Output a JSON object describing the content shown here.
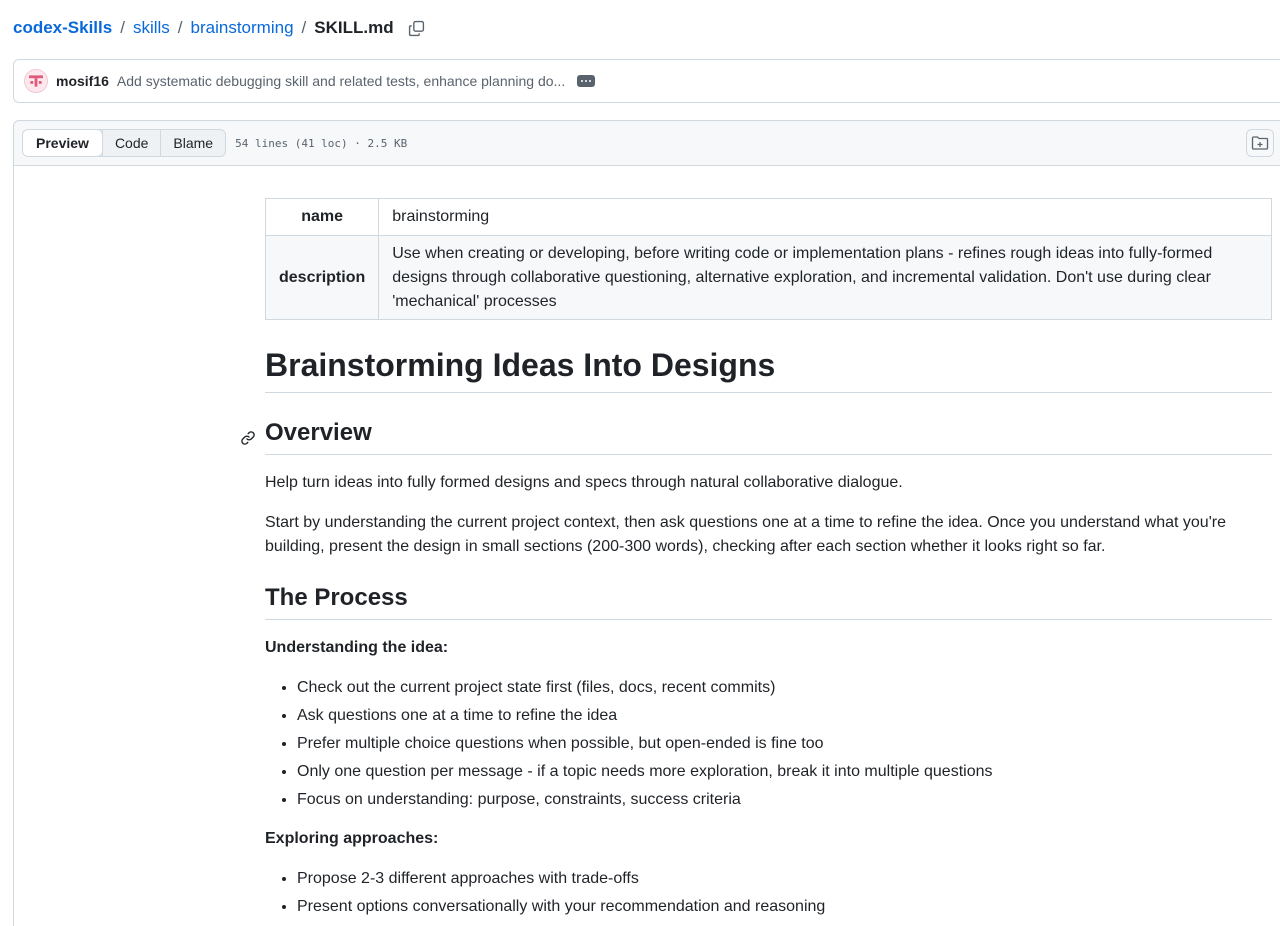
{
  "breadcrumb": {
    "repo": "codex-Skills",
    "sep": "/",
    "path": [
      "skills",
      "brainstorming"
    ],
    "file": "SKILL.md"
  },
  "commit": {
    "author": "mosif16",
    "message": "Add systematic debugging skill and related tests, enhance planning do..."
  },
  "file_header": {
    "tabs": [
      "Preview",
      "Code",
      "Blame"
    ],
    "active_tab": "Preview",
    "meta": "54 lines (41 loc) · 2.5 KB"
  },
  "frontmatter": {
    "rows": [
      {
        "key": "name",
        "value": "brainstorming"
      },
      {
        "key": "description",
        "value": "Use when creating or developing, before writing code or implementation plans - refines rough ideas into fully-formed designs through collaborative questioning, alternative exploration, and incremental validation. Don't use during clear 'mechanical' processes"
      }
    ]
  },
  "doc": {
    "title": "Brainstorming Ideas Into Designs",
    "overview": {
      "heading": "Overview",
      "p1": "Help turn ideas into fully formed designs and specs through natural collaborative dialogue.",
      "p2": "Start by understanding the current project context, then ask questions one at a time to refine the idea. Once you understand what you're building, present the design in small sections (200-300 words), checking after each section whether it looks right so far."
    },
    "process": {
      "heading": "The Process",
      "understanding": {
        "label": "Understanding the idea:",
        "items": [
          "Check out the current project state first (files, docs, recent commits)",
          "Ask questions one at a time to refine the idea",
          "Prefer multiple choice questions when possible, but open-ended is fine too",
          "Only one question per message - if a topic needs more exploration, break it into multiple questions",
          "Focus on understanding: purpose, constraints, success criteria"
        ]
      },
      "exploring": {
        "label": "Exploring approaches:",
        "items": [
          "Propose 2-3 different approaches with trade-offs",
          "Present options conversationally with your recommendation and reasoning"
        ]
      }
    }
  },
  "icons": {
    "copy": "copy-icon",
    "avatar": "avatar-identicon",
    "more": "ellipsis-icon",
    "outline": "file-directory-icon",
    "anchor": "link-icon"
  },
  "colors": {
    "link": "#0969da",
    "border": "#d1d9e0",
    "header_bg": "#f6f8fa",
    "avatar": "#e0587a"
  }
}
